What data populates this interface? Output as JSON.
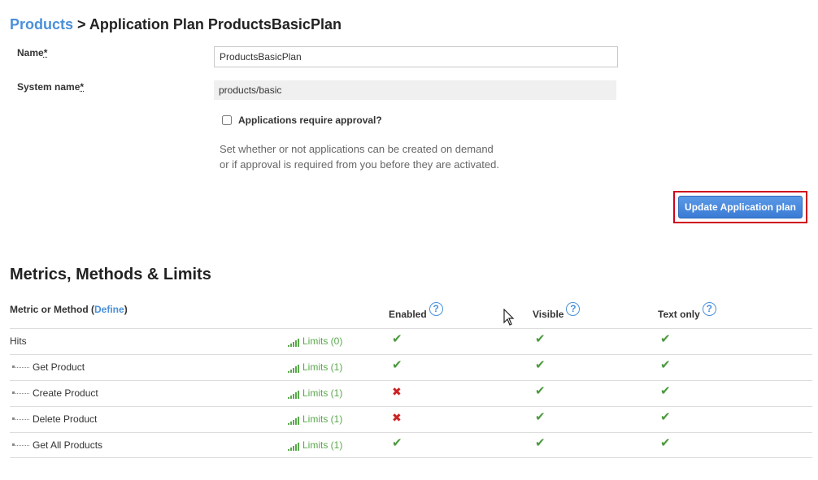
{
  "breadcrumb": {
    "parent": "Products",
    "separator": ">",
    "current": "Application Plan ProductsBasicPlan"
  },
  "form": {
    "name_label": "Name",
    "name_value": "ProductsBasicPlan",
    "system_name_label": "System name",
    "system_name_value": "products/basic",
    "required_marker": "*",
    "approval_label": "Applications require approval?",
    "approval_checked": false,
    "hint_line1": "Set whether or not applications can be created on demand",
    "hint_line2": "or if approval is required from you before they are activated.",
    "submit_label": "Update Application plan"
  },
  "metrics": {
    "section_title": "Metrics, Methods & Limits",
    "col_metric": "Metric or Method (",
    "col_define": "Define",
    "col_metric_close": ")",
    "col_enabled": "Enabled",
    "col_visible": "Visible",
    "col_text_only": "Text only",
    "help_glyph": "?",
    "rows": [
      {
        "name": "Hits",
        "limits": "Limits (0)",
        "enabled": "✔",
        "visible": "✔",
        "text_only": "✔"
      },
      {
        "name": "Get Product",
        "limits": "Limits (1)",
        "enabled": "✔",
        "visible": "✔",
        "text_only": "✔"
      },
      {
        "name": "Create Product",
        "limits": "Limits (1)",
        "enabled": "✖",
        "visible": "✔",
        "text_only": "✔"
      },
      {
        "name": "Delete Product",
        "limits": "Limits (1)",
        "enabled": "✖",
        "visible": "✔",
        "text_only": "✔"
      },
      {
        "name": "Get All Products",
        "limits": "Limits (1)",
        "enabled": "✔",
        "visible": "✔",
        "text_only": "✔"
      }
    ]
  },
  "colors": {
    "link": "#4a90d9",
    "limits": "#5aa84c",
    "check": "#4a9a3c",
    "cross": "#cc2222",
    "highlight": "#d0021b"
  }
}
